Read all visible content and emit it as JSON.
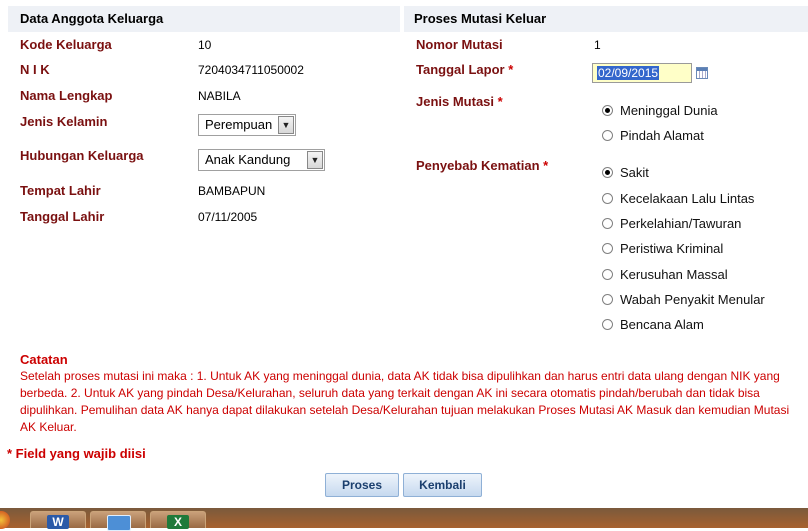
{
  "left_panel": {
    "title": "Data Anggota Keluarga",
    "fields": {
      "kode_keluarga": {
        "label": "Kode Keluarga",
        "value": "10"
      },
      "nik": {
        "label": "N I K",
        "value": "7204034711050002"
      },
      "nama_lengkap": {
        "label": "Nama Lengkap",
        "value": "NABILA"
      },
      "jenis_kelamin": {
        "label": "Jenis Kelamin",
        "value": "Perempuan"
      },
      "hubungan_keluarga": {
        "label": "Hubungan Keluarga",
        "value": "Anak Kandung"
      },
      "tempat_lahir": {
        "label": "Tempat Lahir",
        "value": "BAMBAPUN"
      },
      "tanggal_lahir": {
        "label": "Tanggal Lahir",
        "value": "07/11/2005"
      }
    }
  },
  "right_panel": {
    "title": "Proses Mutasi Keluar",
    "nomor_mutasi": {
      "label": "Nomor Mutasi",
      "value": "1"
    },
    "tanggal_lapor": {
      "label": "Tanggal Lapor",
      "required_mark": "*",
      "value": "02/09/2015"
    },
    "jenis_mutasi": {
      "label": "Jenis Mutasi",
      "required_mark": "*",
      "options": [
        "Meninggal Dunia",
        "Pindah Alamat"
      ],
      "selected": "Meninggal Dunia"
    },
    "penyebab_kematian": {
      "label": "Penyebab Kematian",
      "required_mark": "*",
      "options": [
        "Sakit",
        "Kecelakaan Lalu Lintas",
        "Perkelahian/Tawuran",
        "Peristiwa Kriminal",
        "Kerusuhan Massal",
        "Wabah Penyakit Menular",
        "Bencana Alam"
      ],
      "selected": "Sakit"
    }
  },
  "note": {
    "title": "Catatan",
    "body": "Setelah proses mutasi ini maka : 1. Untuk AK yang meninggal dunia, data AK tidak bisa dipulihkan dan harus entri data ulang dengan NIK yang berbeda. 2. Untuk AK yang pindah Desa/Kelurahan, seluruh data yang terkait dengan AK ini secara otomatis pindah/berubah dan tidak bisa dipulihkan. Pemulihan data AK hanya dapat dilakukan setelah Desa/Kelurahan tujuan melakukan Proses Mutasi AK Masuk dan kemudian Mutasi AK Keluar."
  },
  "required_note": "* Field yang wajib diisi",
  "buttons": {
    "proses": "Proses",
    "kembali": "Kembali"
  },
  "taskbar": {
    "apps": [
      "W",
      "X"
    ]
  },
  "colors": {
    "label": "#7a1010",
    "note": "#cc0000",
    "header_bg": "#eef1f6",
    "date_highlight": "#3366cc"
  }
}
